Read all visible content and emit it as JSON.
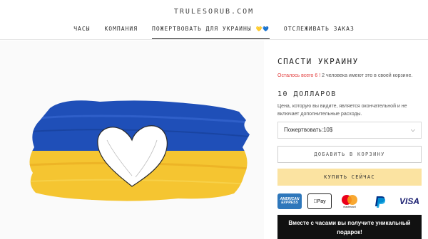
{
  "header": {
    "logo": "TRULESORUB.COM",
    "nav": [
      {
        "label": "ЧАСЫ"
      },
      {
        "label": "КОМПАНИЯ"
      },
      {
        "label": "ПОЖЕРТВОВАТЬ ДЛЯ УКРАИНЫ",
        "suffix": "💛💙",
        "active": true
      },
      {
        "label": "ОТСЛЕЖИВАТЬ ЗАКАЗ"
      }
    ]
  },
  "product": {
    "title": "СПАСТИ УКРАИНУ",
    "stock_warning": "Осталось всего 6 !",
    "stock_rest": "2 человека имеют это в своей корзине.",
    "price": "10 ДОЛЛАРОВ",
    "price_note": "Цена, которую вы видите, является окончательной и не включает дополнительные расходы.",
    "variant_selected": "Пожертвовать:10$",
    "add_to_cart": "ДОБАВИТЬ В КОРЗИНУ",
    "buy_now": "КУПИТЬ СЕЙЧАС"
  },
  "payments": {
    "amex": "AMERICAN EXPRESS",
    "apple": "Pay",
    "mastercard": "mastercard",
    "visa": "VISA"
  },
  "promo": "Вместе с часами вы получите уникальный подарок!",
  "colors": {
    "flag_blue": "#1f4fb8",
    "flag_yellow": "#f5c531",
    "buy_button": "#fbe3a1",
    "warning": "#e23b3b"
  }
}
